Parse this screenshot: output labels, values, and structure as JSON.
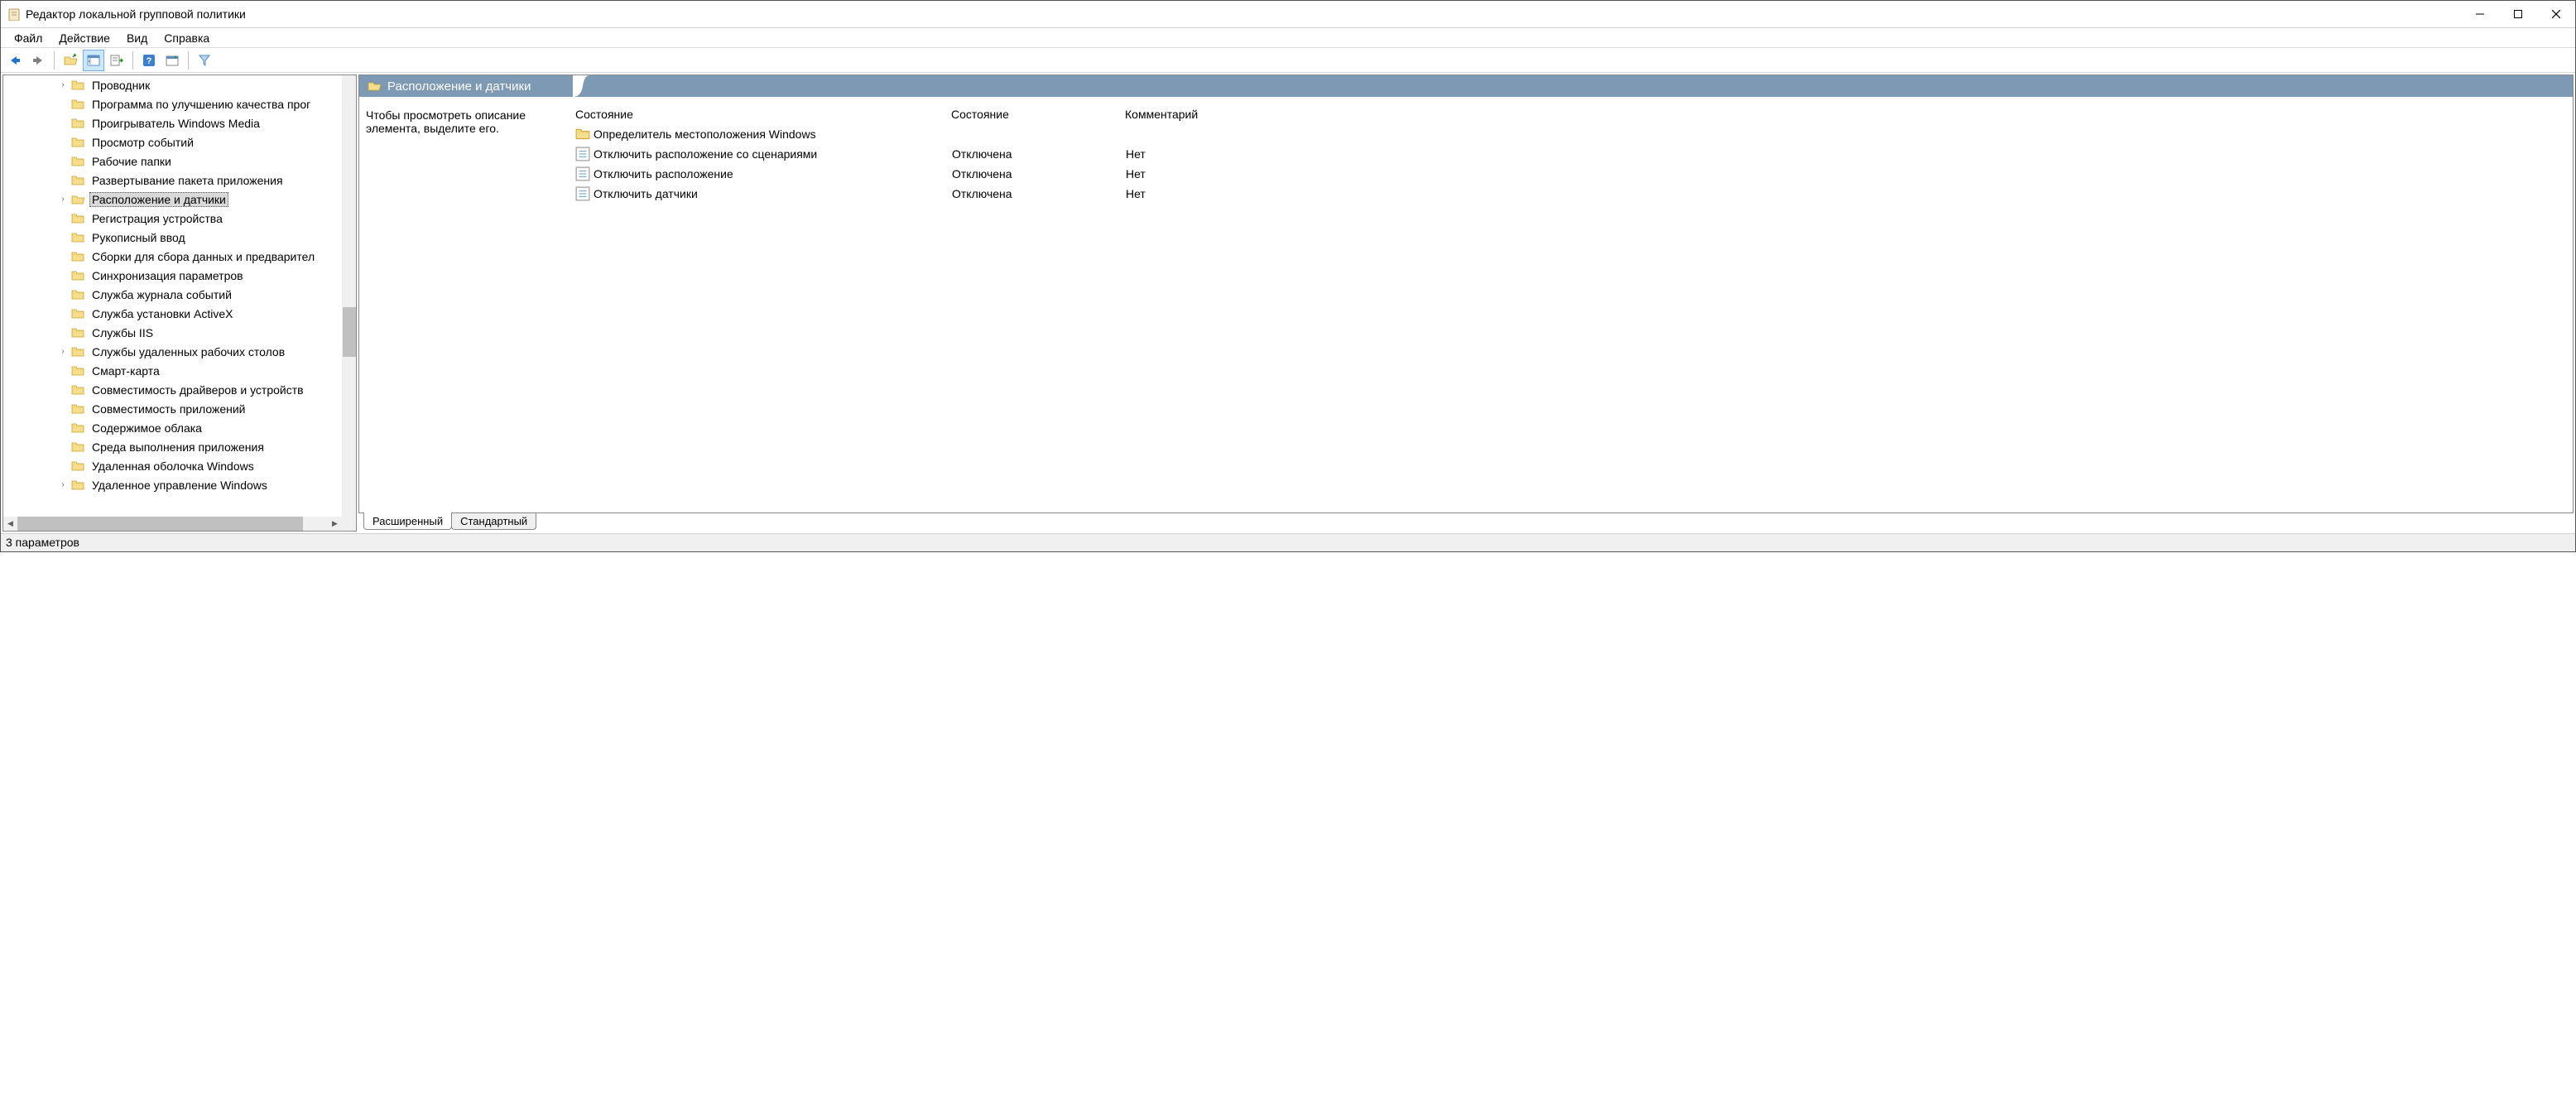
{
  "title": "Редактор локальной групповой политики",
  "menubar": {
    "file": "Файл",
    "action": "Действие",
    "view": "Вид",
    "help": "Справка"
  },
  "tree": {
    "items": [
      {
        "label": "Проводник",
        "expandable": true
      },
      {
        "label": "Программа по улучшению качества прог"
      },
      {
        "label": "Проигрыватель Windows Media"
      },
      {
        "label": "Просмотр событий"
      },
      {
        "label": "Рабочие папки"
      },
      {
        "label": "Развертывание пакета приложения"
      },
      {
        "label": "Расположение и датчики",
        "expandable": true,
        "selected": true
      },
      {
        "label": "Регистрация устройства"
      },
      {
        "label": "Рукописный ввод"
      },
      {
        "label": "Сборки для сбора данных и предварител"
      },
      {
        "label": "Синхронизация параметров"
      },
      {
        "label": "Служба журнала событий"
      },
      {
        "label": "Служба установки ActiveX"
      },
      {
        "label": "Службы IIS"
      },
      {
        "label": "Службы удаленных рабочих столов",
        "expandable": true
      },
      {
        "label": "Смарт-карта"
      },
      {
        "label": "Совместимость драйверов и устройств"
      },
      {
        "label": "Совместимость приложений"
      },
      {
        "label": "Содержимое облака"
      },
      {
        "label": "Среда выполнения приложения"
      },
      {
        "label": "Удаленная оболочка Windows"
      },
      {
        "label": "Удаленное управление Windows",
        "expandable": true
      }
    ]
  },
  "right": {
    "banner_title": "Расположение и датчики",
    "description": "Чтобы просмотреть описание элемента, выделите его.",
    "headers": {
      "name": "Состояние",
      "state": "Состояние",
      "comment": "Комментарий"
    },
    "rows": [
      {
        "type": "folder",
        "name": "Определитель местоположения Windows",
        "state": "",
        "comment": ""
      },
      {
        "type": "setting",
        "name": "Отключить расположение со сценариями",
        "state": "Отключена",
        "comment": "Нет"
      },
      {
        "type": "setting",
        "name": "Отключить расположение",
        "state": "Отключена",
        "comment": "Нет"
      },
      {
        "type": "setting",
        "name": "Отключить датчики",
        "state": "Отключена",
        "comment": "Нет"
      }
    ],
    "tabs": {
      "extended": "Расширенный",
      "standard": "Стандартный"
    }
  },
  "statusbar": "3 параметров"
}
